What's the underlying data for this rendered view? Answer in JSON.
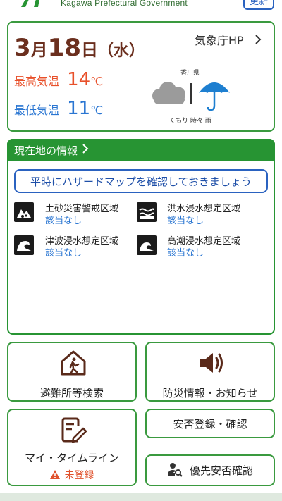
{
  "header": {
    "org_subtitle": "Kagawa Prefectural Government",
    "update_label": "更新"
  },
  "weather": {
    "date": {
      "month": "3",
      "month_unit": "月",
      "day": "18",
      "day_unit": "日",
      "dow": "（水）"
    },
    "jma_link": "気象庁HP",
    "high_label": "最高気温",
    "high_value": "14",
    "low_label": "最低気温",
    "low_value": "11",
    "unit": "℃",
    "prefecture": "香川県",
    "forecast": "くもり 時々 雨",
    "icons": [
      "cloud-icon",
      "umbrella-icon"
    ]
  },
  "location_info": {
    "title": "現在地の情報",
    "hazard_button": "平時にハザードマップを確認しておきましょう",
    "hazards": [
      {
        "name": "土砂災害警戒区域",
        "status": "該当なし",
        "icon": "landslide-icon"
      },
      {
        "name": "洪水浸水想定区域",
        "status": "該当なし",
        "icon": "flood-icon"
      },
      {
        "name": "津波浸水想定区域",
        "status": "該当なし",
        "icon": "tsunami-icon"
      },
      {
        "name": "高潮浸水想定区域",
        "status": "該当なし",
        "icon": "storm-surge-icon"
      }
    ]
  },
  "menu": {
    "shelter_search": "避難所等検索",
    "disaster_info": "防災情報・お知らせ",
    "timeline": "マイ・タイムライン",
    "timeline_status": "未登録",
    "safety_register": "安否登録・確認",
    "priority_safety": "優先安否確認"
  },
  "colors": {
    "brand_green": "#3a9a3f",
    "link_blue": "#2a62c0",
    "high_temp": "#e8502a",
    "low_temp": "#2a76d2"
  }
}
